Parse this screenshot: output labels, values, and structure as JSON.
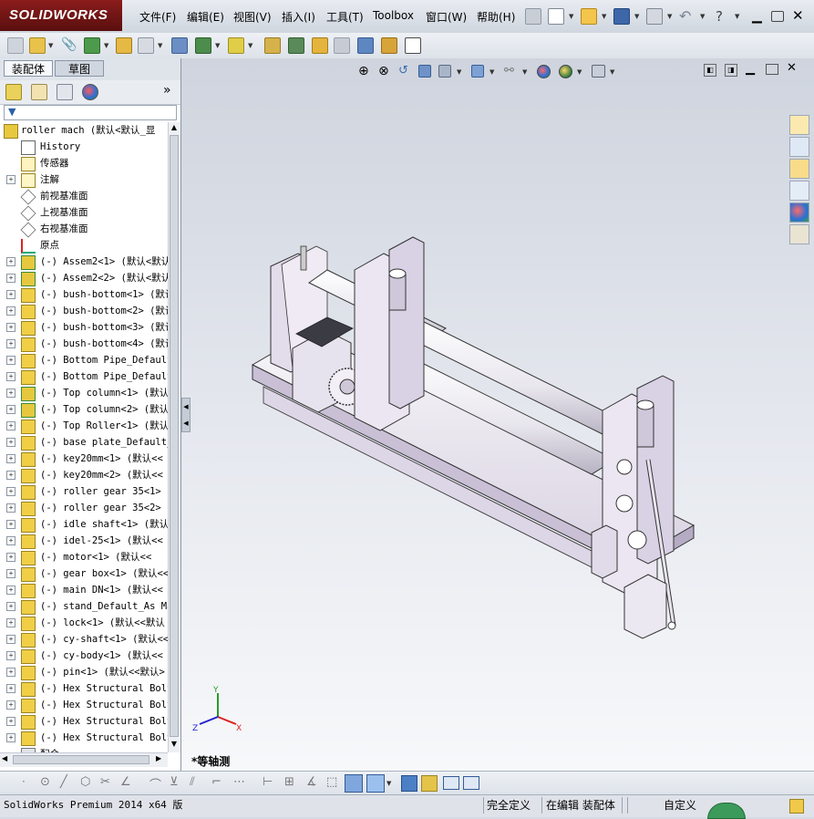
{
  "app": {
    "logo": "SOLIDWORKS"
  },
  "menu": [
    {
      "label": "文件(F)"
    },
    {
      "label": "编辑(E)"
    },
    {
      "label": "视图(V)"
    },
    {
      "label": "插入(I)"
    },
    {
      "label": "工具(T)"
    },
    {
      "label": "Toolbox"
    },
    {
      "label": "窗口(W)"
    },
    {
      "label": "帮助(H)"
    }
  ],
  "panel_tabs": {
    "assembly": "装配体",
    "sketch": "草图"
  },
  "feature_tree": {
    "root": "roller mach  (默认<默认_显",
    "items": [
      {
        "label": "History",
        "icon": "history-icon",
        "expandable": false
      },
      {
        "label": "传感器",
        "icon": "sensor-icon",
        "expandable": false
      },
      {
        "label": "注解",
        "icon": "annotation-icon",
        "expandable": true
      },
      {
        "label": "前视基准面",
        "icon": "plane-icon",
        "expandable": false
      },
      {
        "label": "上视基准面",
        "icon": "plane-icon",
        "expandable": false
      },
      {
        "label": "右视基准面",
        "icon": "plane-icon",
        "expandable": false
      },
      {
        "label": "原点",
        "icon": "origin-icon",
        "expandable": false
      },
      {
        "label": "(-) Assem2<1> (默认<默认",
        "icon": "subassembly-icon",
        "expandable": true
      },
      {
        "label": "(-) Assem2<2> (默认<默认",
        "icon": "subassembly-icon",
        "expandable": true
      },
      {
        "label": "(-) bush-bottom<1> (默认",
        "icon": "part-icon",
        "expandable": true
      },
      {
        "label": "(-) bush-bottom<2> (默认",
        "icon": "part-icon",
        "expandable": true
      },
      {
        "label": "(-) bush-bottom<3> (默认",
        "icon": "part-icon",
        "expandable": true
      },
      {
        "label": "(-) bush-bottom<4> (默认",
        "icon": "part-icon",
        "expandable": true
      },
      {
        "label": "(-) Bottom Pipe_Default",
        "icon": "part-icon",
        "expandable": true
      },
      {
        "label": "(-) Bottom Pipe_Default",
        "icon": "part-icon",
        "expandable": true
      },
      {
        "label": "(-) Top column<1> (默认",
        "icon": "subassembly-icon",
        "expandable": true
      },
      {
        "label": "(-) Top column<2> (默认",
        "icon": "subassembly-icon",
        "expandable": true
      },
      {
        "label": "(-) Top Roller<1> (默认",
        "icon": "part-icon",
        "expandable": true
      },
      {
        "label": "(-) base plate_Default_",
        "icon": "part-icon",
        "expandable": true
      },
      {
        "label": "(-) key20mm<1> (默认<<",
        "icon": "part-icon",
        "expandable": true
      },
      {
        "label": "(-) key20mm<2> (默认<<",
        "icon": "part-icon",
        "expandable": true
      },
      {
        "label": "(-) roller gear 35<1> (",
        "icon": "part-icon",
        "expandable": true
      },
      {
        "label": "(-) roller gear 35<2> (",
        "icon": "part-icon",
        "expandable": true
      },
      {
        "label": "(-) idle shaft<1> (默认",
        "icon": "part-icon",
        "expandable": true
      },
      {
        "label": "(-) idel-25<1> (默认<<",
        "icon": "part-icon",
        "expandable": true
      },
      {
        "label": "(-) motor<1> (默认<<",
        "icon": "part-icon",
        "expandable": true
      },
      {
        "label": "(-) gear box<1> (默认<<",
        "icon": "part-icon",
        "expandable": true
      },
      {
        "label": "(-) main DN<1> (默认<<",
        "icon": "part-icon",
        "expandable": true
      },
      {
        "label": "(-) stand_Default_As Ma",
        "icon": "part-icon",
        "expandable": true
      },
      {
        "label": "(-) lock<1> (默认<<默认",
        "icon": "part-icon",
        "expandable": true
      },
      {
        "label": "(-) cy-shaft<1> (默认<<",
        "icon": "part-icon",
        "expandable": true
      },
      {
        "label": "(-) cy-body<1> (默认<<",
        "icon": "part-icon",
        "expandable": true
      },
      {
        "label": "(-) pin<1> (默认<<默认>",
        "icon": "part-icon",
        "expandable": true
      },
      {
        "label": "(-) Hex Structural Bolt",
        "icon": "part-icon",
        "expandable": true
      },
      {
        "label": "(-) Hex Structural Bolt",
        "icon": "part-icon",
        "expandable": true
      },
      {
        "label": "(-) Hex Structural Bolt",
        "icon": "part-icon",
        "expandable": true
      },
      {
        "label": "(-) Hex Structural Bolt",
        "icon": "part-icon",
        "expandable": true
      },
      {
        "label": "配合",
        "icon": "mates-icon",
        "expandable": false
      }
    ]
  },
  "viewport": {
    "view_name": "*等轴测",
    "triad": {
      "x": "X",
      "y": "Y",
      "z": "Z"
    }
  },
  "statusbar": {
    "app_version": "SolidWorks Premium 2014 x64 版",
    "definition": "完全定义",
    "editing": "在编辑 装配体",
    "custom": "自定义"
  },
  "colors": {
    "logo_bg": "#7a1616",
    "panel_bg": "#ffffff",
    "accent": "#3a6fb0"
  }
}
